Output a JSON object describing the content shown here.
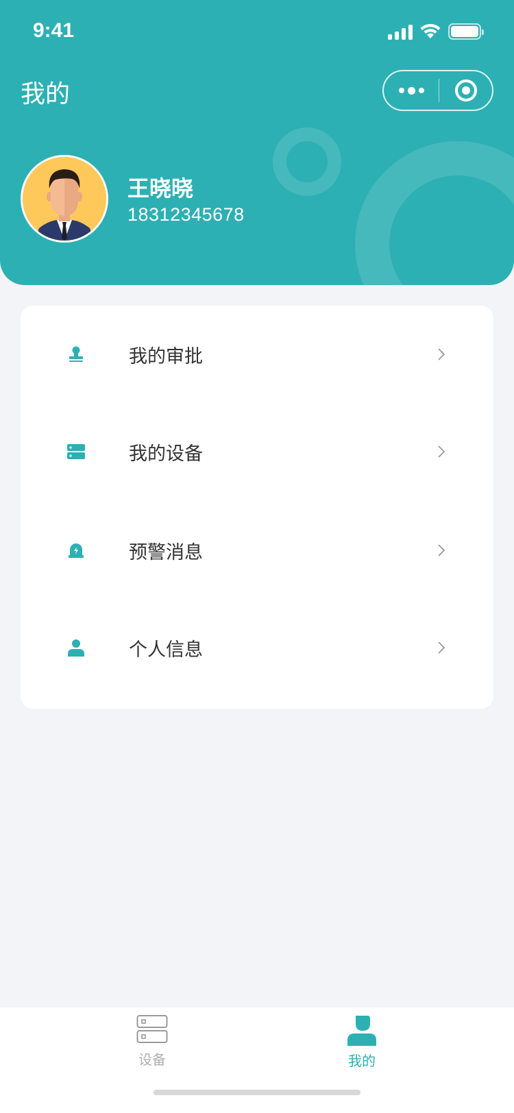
{
  "status_bar": {
    "time": "9:41"
  },
  "header": {
    "title": "我的",
    "capsule": {
      "more_icon": "more-dots-icon",
      "close_icon": "target-circle-icon"
    }
  },
  "profile": {
    "avatar_icon": "user-avatar",
    "name": "王晓晓",
    "phone": "18312345678"
  },
  "menu": {
    "items": [
      {
        "label": "我的审批",
        "icon": "stamp-icon"
      },
      {
        "label": "我的设备",
        "icon": "server-icon"
      },
      {
        "label": "预警消息",
        "icon": "alarm-light-icon"
      },
      {
        "label": "个人信息",
        "icon": "person-icon"
      }
    ]
  },
  "tabbar": {
    "tabs": [
      {
        "label": "设备",
        "icon": "device-icon",
        "active": false
      },
      {
        "label": "我的",
        "icon": "profile-icon",
        "active": true
      }
    ]
  },
  "colors": {
    "primary": "#2db0b3",
    "background": "#f3f4f8",
    "text": "#333333",
    "inactive": "#b0b0b0"
  }
}
